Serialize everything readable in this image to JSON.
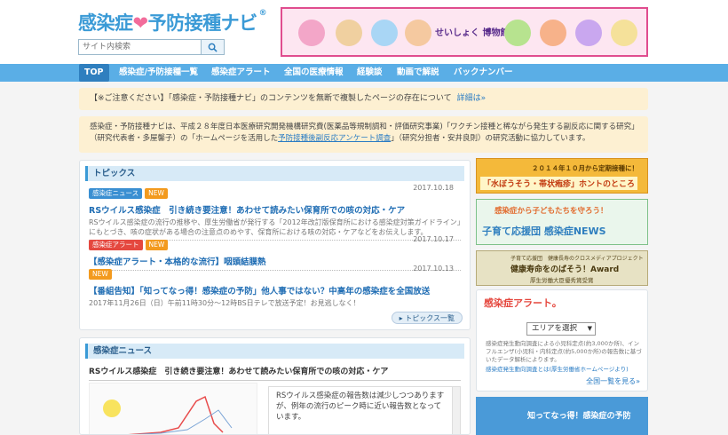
{
  "header": {
    "logo_text": "感染症",
    "logo_heart": "❤",
    "logo_text2": "予防接種ナビ",
    "logo_reg": "®",
    "search_placeholder": "サイト内検索",
    "search_icon": "magnifier-icon"
  },
  "banner": {
    "text": "せいしょく 博物館"
  },
  "nav": {
    "items": [
      "TOP",
      "感染症/予防接種一覧",
      "感染症アラート",
      "全国の医療情報",
      "経験談",
      "動画で解説",
      "バックナンバー"
    ]
  },
  "notice": {
    "text": "【※ご注意ください】「感染症・予防接種ナビ」のコンテンツを無断で複製したページの存在について",
    "link": "詳細は»"
  },
  "intro": {
    "part1": "感染症・予防接種ナビは、平成２８年度日本医療研究開発機構研究費(医薬品等規制調和・評価研究事業)「ワクチン接種と稀ながら発生する副反応に関する研究」（研究代表者・多屋馨子）の「ホームページを活用した",
    "link": "予防接種後副反応アンケート調査",
    "part2": "」（研究分担者・安井良則）の研究活動に協力しています。"
  },
  "topics": {
    "header": "トピックス",
    "items": [
      {
        "tag": "感染症ニュース",
        "new": "NEW",
        "date": "2017.10.18",
        "title": "RSウイルス感染症　引き続き要注意！あわせて読みたい保育所での咳の対応・ケア",
        "body": "RSウイルス感染症の流行の推移や、厚生労働省が発行する「2012年改訂版保育所における感染症対策ガイドライン」にもとづき、咳の症状がある場合の注意点のめやす、保育所における咳の対応・ケアなどをお伝えします。"
      },
      {
        "tag": "感染症アラート",
        "new": "NEW",
        "date": "2017.10.17",
        "title": "【感染症アラート・本格的な流行】咽頭結膜熱",
        "body": ""
      },
      {
        "tag": "",
        "new": "NEW",
        "date": "2017.10.13",
        "title": "【番組告知】「知ってなっ得！感染症の予防」他人事ではない？中高年の感染症を全国放送",
        "body": "2017年11月26日（日）午前11時30分～12時BS日テレで放送予定！お見逃しなく！"
      }
    ],
    "more": "トピックス一覧"
  },
  "news": {
    "header": "感染症ニュース",
    "title": "RSウイルス感染症　引き続き要注意！あわせて読みたい保育所での咳の対応・ケア",
    "text": "RSウイルス感染症の報告数は減少しつつありますが、例年の流行のピーク時に近い報告数となっています。"
  },
  "side": {
    "ad1_text": "２０１４年１０月から定期接種に！",
    "ad1_title": "「水ぼうそう・帯状疱疹」ホントのところ",
    "ad2_top": "感染症から子どもたちを守ろう！",
    "ad2_main": "子育て応援団 感染症NEWS",
    "ad3_top": "子育て応援団　健康長寿のクロスメディアプロジェクト",
    "ad3_main": "健康寿命をのばそう！Award",
    "ad3_sub": "厚生労働大臣優秀賞受賞",
    "alert_title": "感染症アラート。",
    "area_select": "エリアを選択",
    "alert_note": "感染症発生動向調査による小児科定点(約3,000か所)、インフルエンザ(小児科・内科定点(約5,000か所)の報告数に基づいたデータ解析によります。",
    "alert_note_link": "感染症発生動向調査とは(厚生労働省ホームページより)",
    "alert_more": "全国一覧を見る»",
    "ad5_text": "知ってなっ得！感染症の予防"
  }
}
